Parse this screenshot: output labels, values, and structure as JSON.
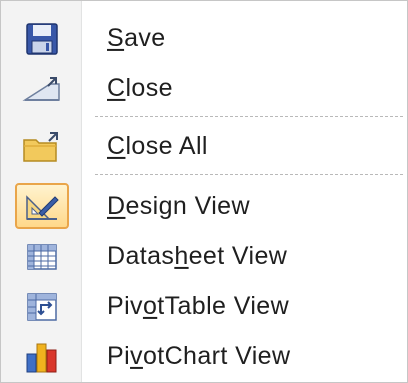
{
  "menu": {
    "items": [
      {
        "pre": "",
        "u": "S",
        "post": "ave",
        "icon": "save-icon"
      },
      {
        "pre": "",
        "u": "C",
        "post": "lose",
        "icon": "close-object-icon"
      },
      {
        "pre": "",
        "u": "C",
        "post": "lose All",
        "icon": "close-all-folder-icon"
      },
      {
        "pre": "",
        "u": "D",
        "post": "esign View",
        "icon": "design-view-icon"
      },
      {
        "pre": "Datas",
        "u": "h",
        "post": "eet View",
        "icon": "datasheet-view-icon"
      },
      {
        "pre": "Piv",
        "u": "o",
        "post": "tTable View",
        "icon": "pivottable-view-icon"
      },
      {
        "pre": "Pi",
        "u": "v",
        "post": "otChart View",
        "icon": "pivotchart-view-icon"
      }
    ]
  }
}
